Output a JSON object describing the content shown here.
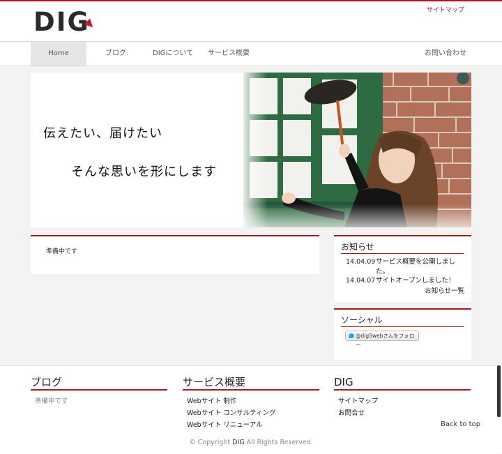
{
  "header": {
    "logo": "DIG",
    "sitemap_link": "サイトマップ"
  },
  "nav": {
    "items": [
      {
        "label": "Home"
      },
      {
        "label": "ブログ"
      },
      {
        "label": "DIGについて"
      },
      {
        "label": "サービス概要"
      }
    ],
    "contact": "お問い合わせ"
  },
  "hero": {
    "line1": "伝えたい、届けたい",
    "line2": "そんな思いを形にします"
  },
  "main": {
    "text": "準備中です"
  },
  "news": {
    "title": "お知らせ",
    "items": [
      {
        "date": "14.04.09",
        "text": "サービス概要を公開しました。"
      },
      {
        "date": "14.04.07",
        "text": "サイトオープンしました！"
      }
    ],
    "more": "お知らせ一覧"
  },
  "social": {
    "title": "ソーシャル",
    "follow_button": "@dig5webさんをフォロー"
  },
  "footer": {
    "blog": {
      "title": "ブログ",
      "text": "準備中です"
    },
    "services": {
      "title": "サービス概要",
      "links": [
        "Webサイト 制作",
        "Webサイト コンサルティング",
        "Webサイト リニューアル"
      ]
    },
    "dig": {
      "title": "DIG",
      "links": [
        "サイトマップ",
        "お問合せ"
      ]
    },
    "back_to_top": "Back to top",
    "copyright_prefix": "© Copyright ",
    "copyright_brand": "DIG",
    "copyright_suffix": " All Rights Reserved."
  },
  "colors": {
    "accent": "#a31a1f",
    "logo_arrow": "#c21d23"
  }
}
